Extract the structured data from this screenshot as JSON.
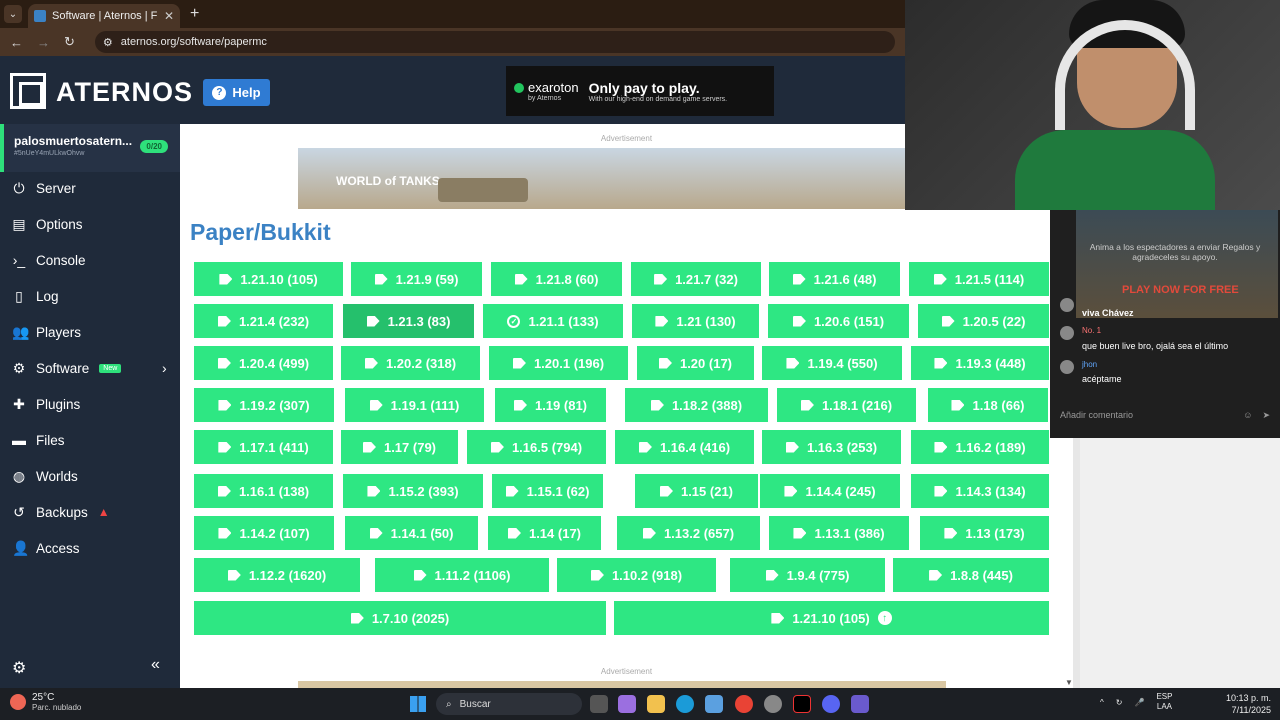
{
  "browser": {
    "tab_title": "Software | Aternos | Free Minec",
    "url": "aternos.org/software/papermc"
  },
  "header": {
    "logo_text": "ATERNOS",
    "help_label": "Help",
    "ad_brand": "exaroton",
    "ad_brand_sub": "by Aternos",
    "ad_tagline": "Only pay to play.",
    "ad_subtext": "With our high-end on demand game servers."
  },
  "server": {
    "name": "palosmuertosatern...",
    "id": "#5nUeY4mULkwOhvw",
    "players": "0/20"
  },
  "sidebar": {
    "items": [
      {
        "label": "Server",
        "icon": "power-icon"
      },
      {
        "label": "Options",
        "icon": "list-icon"
      },
      {
        "label": "Console",
        "icon": "terminal-icon"
      },
      {
        "label": "Log",
        "icon": "file-icon"
      },
      {
        "label": "Players",
        "icon": "users-icon"
      },
      {
        "label": "Software",
        "icon": "puzzle-icon"
      },
      {
        "label": "Plugins",
        "icon": "plugin-icon"
      },
      {
        "label": "Files",
        "icon": "folder-icon"
      },
      {
        "label": "Worlds",
        "icon": "globe-icon"
      },
      {
        "label": "Backups",
        "icon": "backup-icon"
      },
      {
        "label": "Access",
        "icon": "user-plus-icon"
      }
    ],
    "new_badge": "New"
  },
  "main": {
    "ad_label": "Advertisement",
    "ad_game": "WORLD of TANKS",
    "title": "Paper/Bukkit",
    "versions": [
      "1.21.10 (105)",
      "1.21.9 (59)",
      "1.21.8 (60)",
      "1.21.7 (32)",
      "1.21.6 (48)",
      "1.21.5 (114)",
      "1.21.4 (232)",
      "1.21.3 (83)",
      "1.21.1 (133)",
      "1.21 (130)",
      "1.20.6 (151)",
      "1.20.5 (22)",
      "1.20.4 (499)",
      "1.20.2 (318)",
      "1.20.1 (196)",
      "1.20 (17)",
      "1.19.4 (550)",
      "1.19.3 (448)",
      "1.19.2 (307)",
      "1.19.1 (111)",
      "1.19 (81)",
      "1.18.2 (388)",
      "1.18.1 (216)",
      "1.18 (66)",
      "1.17.1 (411)",
      "1.17 (79)",
      "1.16.5 (794)",
      "1.16.4 (416)",
      "1.16.3 (253)",
      "1.16.2 (189)",
      "1.16.1 (138)",
      "1.15.2 (393)",
      "1.15.1 (62)",
      "1.15 (21)",
      "1.14.4 (245)",
      "1.14.3 (134)",
      "1.14.2 (107)",
      "1.14.1 (50)",
      "1.14 (17)",
      "1.13.2 (657)",
      "1.13.1 (386)",
      "1.13 (173)",
      "1.12.2 (1620)",
      "1.11.2 (1106)",
      "1.10.2 (918)",
      "1.9.4 (775)",
      "1.8.8 (445)",
      "1.7.10 (2025)",
      "1.21.10 (105)"
    ]
  },
  "chat": {
    "ad_text": "Anima a los espectadores a enviar Regalos y agradeceles su apoyo.",
    "ad_cta": "PLAY NOW FOR FREE",
    "messages": [
      {
        "user": "",
        "text": "viva Chávez"
      },
      {
        "user": "No. 1",
        "text": "que buen live bro, ojalá sea el último"
      },
      {
        "user": "jhon",
        "text": "acéptame"
      }
    ],
    "input_placeholder": "Añadir comentario"
  },
  "taskbar": {
    "temp": "25°C",
    "weather": "Parc. nublado",
    "search": "Buscar",
    "lang_1": "ESP",
    "lang_2": "LAA",
    "time": "10:13 p. m.",
    "date": "7/11/2025"
  },
  "colors": {
    "accent_green": "#2ee783",
    "title_blue": "#3b82c4",
    "sidebar_bg": "#1f2a3a"
  }
}
